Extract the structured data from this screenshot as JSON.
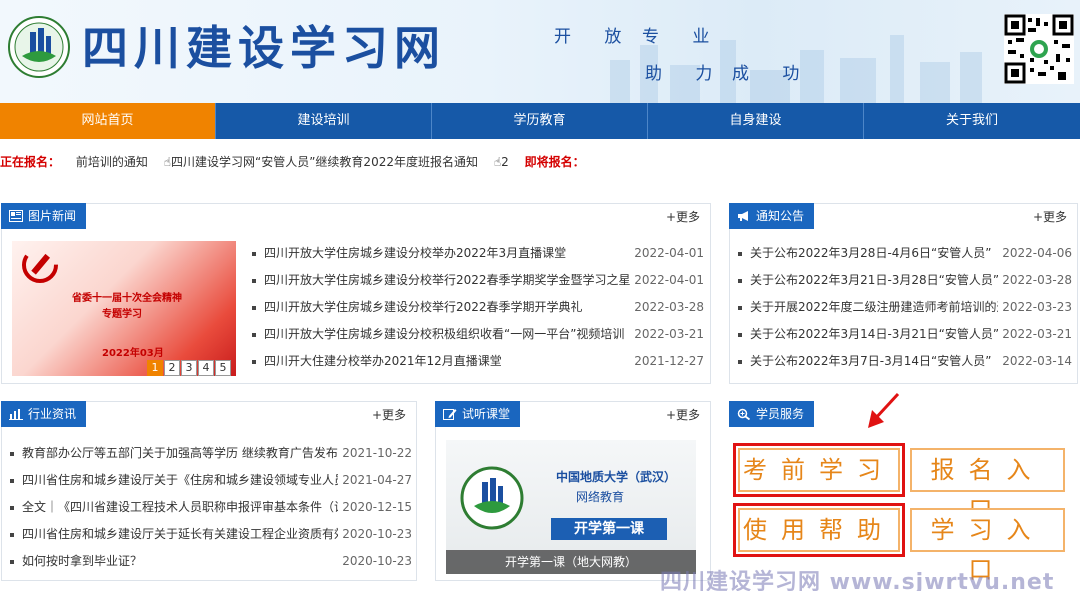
{
  "header": {
    "site_title": "四川建设学习网",
    "slogan_1": "开 放",
    "slogan_2": "专 业",
    "slogan_3": "助 力",
    "slogan_4": "成 功"
  },
  "nav": [
    {
      "label": "网站首页",
      "active": true
    },
    {
      "label": "建设培训",
      "active": false
    },
    {
      "label": "学历教育",
      "active": false
    },
    {
      "label": "自身建设",
      "active": false
    },
    {
      "label": "关于我们",
      "active": false
    }
  ],
  "ticker": {
    "enrolling_label": "正在报名：",
    "item_1": "前培训的通知",
    "item_2": "☝四川建设学习网“安管人员”继续教育2022年度班报名通知",
    "item_3": "☝2",
    "upcoming_label": "即将报名："
  },
  "common": {
    "more": "+更多"
  },
  "photo_news": {
    "title": "图片新闻",
    "slide_caption_1": "省委十一届十次全会精神",
    "slide_caption_2": "专题学习",
    "slide_caption_3": "2022年03月",
    "pages": [
      "1",
      "2",
      "3",
      "4",
      "5"
    ],
    "items": [
      {
        "title": "四川开放大学住房城乡建设分校举办2022年3月直播课堂",
        "date": "2022-04-01"
      },
      {
        "title": "四川开放大学住房城乡建设分校举行2022春季学期奖学金暨学习之星表",
        "date": "2022-04-01"
      },
      {
        "title": "四川开放大学住房城乡建设分校举行2022春季学期开学典礼",
        "date": "2022-03-28"
      },
      {
        "title": "四川开放大学住房城乡建设分校积极组织收看“一网一平台”视频培训",
        "date": "2022-03-21"
      },
      {
        "title": "四川开大住建分校举办2021年12月直播课堂",
        "date": "2021-12-27"
      }
    ]
  },
  "notices": {
    "title": "通知公告",
    "items": [
      {
        "title": "关于公布2022年3月28日-4月6日“安管人员”",
        "date": "2022-04-06"
      },
      {
        "title": "关于公布2022年3月21日-3月28日“安管人员”",
        "date": "2022-03-28"
      },
      {
        "title": "关于开展2022年度二级注册建造师考前培训的通",
        "date": "2022-03-23"
      },
      {
        "title": "关于公布2022年3月14日-3月21日“安管人员”",
        "date": "2022-03-21"
      },
      {
        "title": "关于公布2022年3月7日-3月14日“安管人员”",
        "date": "2022-03-14"
      }
    ]
  },
  "industry": {
    "title": "行业资讯",
    "items": [
      {
        "title": "教育部办公厅等五部门关于加强高等学历 继续教育广告发布",
        "date": "2021-10-22"
      },
      {
        "title": "四川省住房和城乡建设厅关于《住房和城乡建设领域专业人员",
        "date": "2021-04-27"
      },
      {
        "title": "全文｜《四川省建设工程技术人员职称申报评审基本条件（试",
        "date": "2020-12-15"
      },
      {
        "title": "四川省住房和城乡建设厅关于延长有关建设工程企业资质有效",
        "date": "2020-10-23"
      },
      {
        "title": "如何按时拿到毕业证？",
        "date": "2020-10-23"
      }
    ]
  },
  "trial": {
    "title": "试听课堂",
    "video_uni": "中国地质大学（武汉）",
    "video_sub": "网络教育",
    "video_button": "开学第一课",
    "video_caption": "开学第一课（地大网教）"
  },
  "service": {
    "title": "学员服务",
    "btn_exam_prep": "考前学习",
    "btn_register": "报名入口",
    "btn_help": "使用帮助",
    "btn_study": "学习入口"
  },
  "watermark": "四川建设学习网 www.sjwrtvu.net",
  "colors": {
    "nav_blue": "#1659a8",
    "nav_active": "#f08300",
    "tab_blue": "#1a66bf",
    "alert_red": "#d40000",
    "service_orange": "#e68619"
  }
}
